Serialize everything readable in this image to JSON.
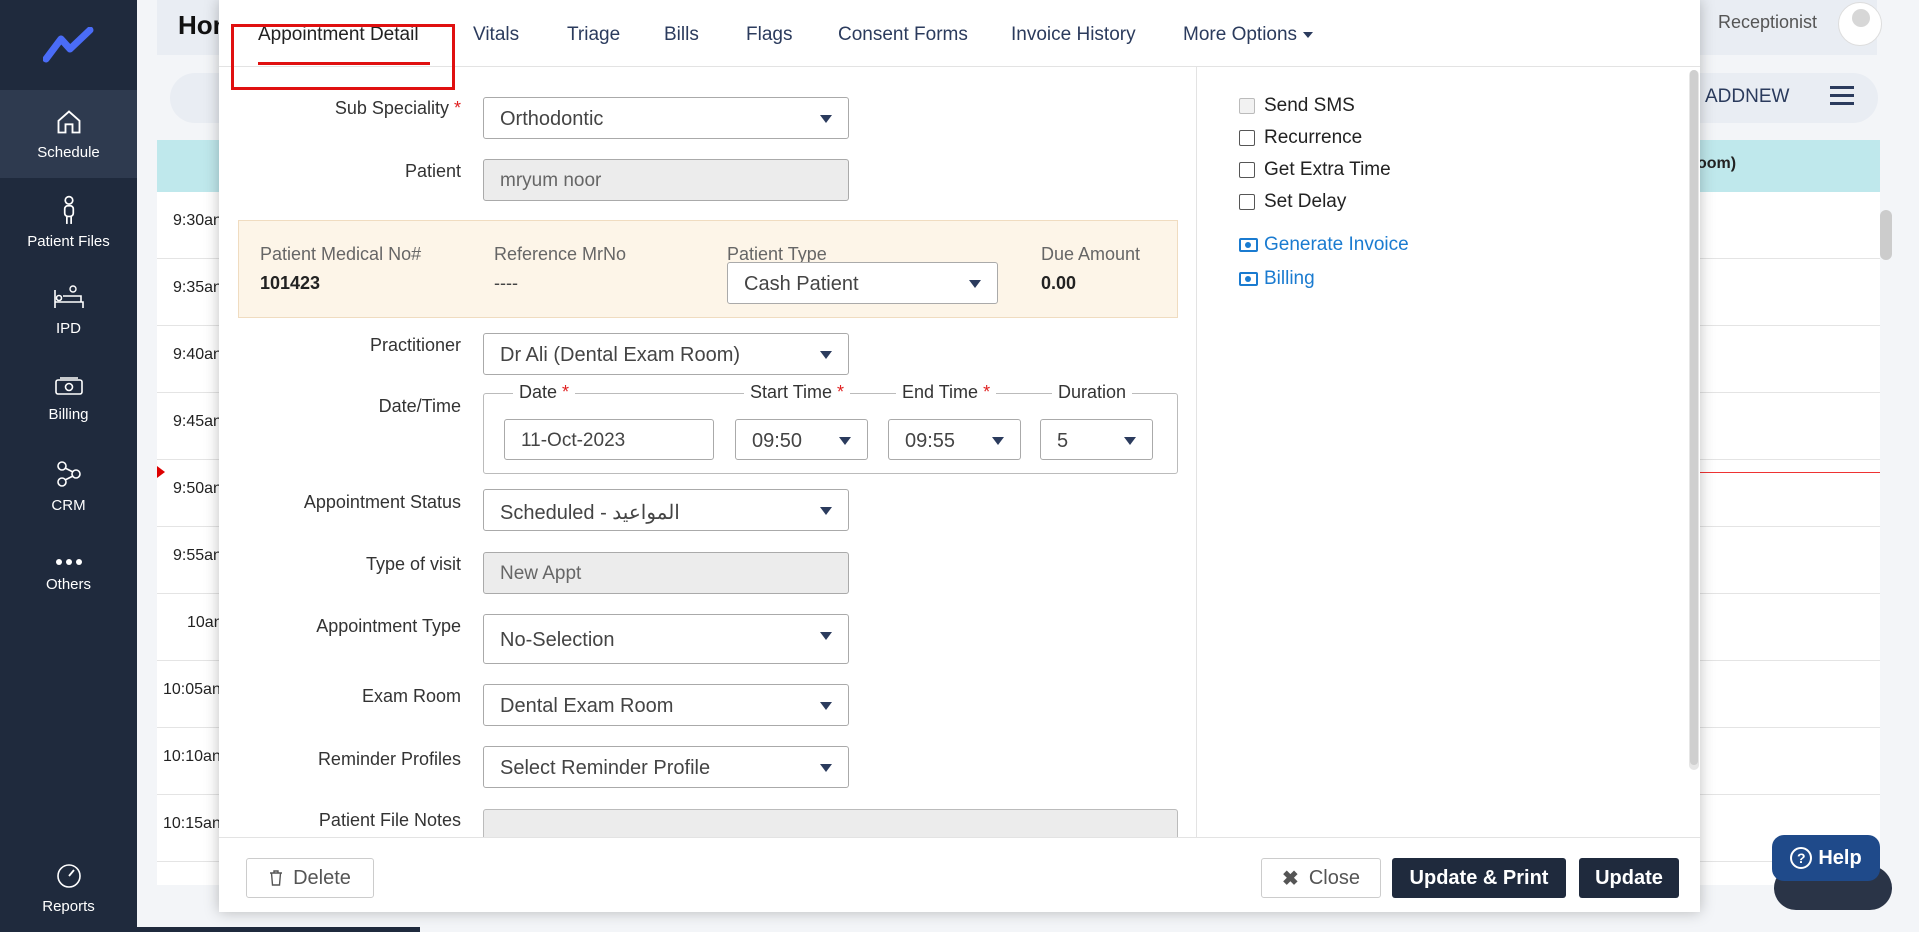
{
  "sidebar": {
    "items": [
      {
        "label": "Schedule",
        "icon": "home-icon"
      },
      {
        "label": "Patient Files",
        "icon": "person-icon"
      },
      {
        "label": "IPD",
        "icon": "bed-icon"
      },
      {
        "label": "Billing",
        "icon": "cash-icon"
      },
      {
        "label": "CRM",
        "icon": "network-icon"
      },
      {
        "label": "Others",
        "icon": "dots-icon"
      }
    ],
    "reports": "Reports"
  },
  "background": {
    "home_title": "Hom",
    "user_role": "Receptionist",
    "addnew": "ADDNEW",
    "room_header": "oom)",
    "times": [
      "9:30an",
      "9:35an",
      "9:40an",
      "9:45an",
      "9:50an",
      "9:55an",
      "10an",
      "10:05an",
      "10:10an",
      "10:15an"
    ],
    "help": "Help"
  },
  "tabs": [
    "Appointment Detail",
    "Vitals",
    "Triage",
    "Bills",
    "Flags",
    "Consent Forms",
    "Invoice History",
    "More Options"
  ],
  "form": {
    "sub_speciality_label": "Sub Speciality",
    "sub_speciality_value": "Orthodontic",
    "patient_label": "Patient",
    "patient_value": "mryum  noor",
    "info": {
      "mrn_label": "Patient Medical No#",
      "mrn_value": "101423",
      "ref_label": "Reference MrNo",
      "ref_value": "----",
      "type_label": "Patient Type",
      "type_value": "Cash Patient",
      "due_label": "Due Amount",
      "due_value": "0.00"
    },
    "practitioner_label": "Practitioner",
    "practitioner_value": "Dr Ali (Dental Exam Room)",
    "datetime_label": "Date/Time",
    "date_label": "Date",
    "date_value": "11-Oct-2023",
    "start_label": "Start Time",
    "start_value": "09:50",
    "end_label": "End Time",
    "end_value": "09:55",
    "duration_label": "Duration",
    "duration_value": "5",
    "status_label": "Appointment Status",
    "status_value": "Scheduled - المواعيد",
    "visit_label": "Type of visit",
    "visit_value": "New Appt",
    "appt_type_label": "Appointment Type",
    "appt_type_value": "No-Selection",
    "exam_room_label": "Exam Room",
    "exam_room_value": "Dental Exam Room",
    "reminder_label": "Reminder Profiles",
    "reminder_value": "Select Reminder Profile",
    "notes_label": "Patient File Notes"
  },
  "options": {
    "send_sms": "Send SMS",
    "recurrence": "Recurrence",
    "extra_time": "Get Extra Time",
    "set_delay": "Set Delay",
    "generate_invoice": "Generate Invoice",
    "billing": "Billing"
  },
  "footer": {
    "delete": "Delete",
    "close": "Close",
    "update_print": "Update & Print",
    "update": "Update"
  }
}
